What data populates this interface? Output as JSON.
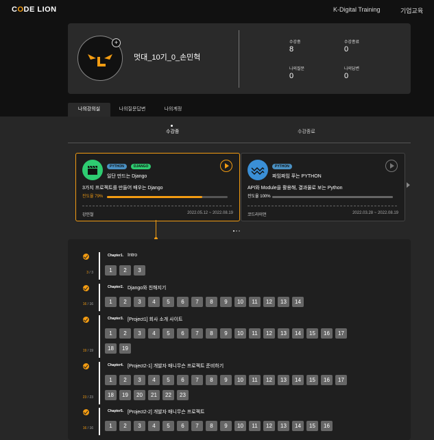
{
  "header": {
    "logo_pre": "C",
    "logo_x": "O",
    "logo_post": "DE LION",
    "nav": [
      "K-Digital Training",
      "기업교육"
    ]
  },
  "profile": {
    "username": "멋대_10기_0_손민혁",
    "stats": [
      {
        "label": "수강중",
        "value": "8"
      },
      {
        "label": "수강종료",
        "value": "0"
      },
      {
        "label": "나의질문",
        "value": "0"
      },
      {
        "label": "나의답변",
        "value": "0"
      }
    ]
  },
  "tabs": [
    "나의강의실",
    "나의질문답변",
    "나의계정"
  ],
  "subtabs": [
    "수강중",
    "수강종료"
  ],
  "colors": {
    "accent": "#f39c12",
    "background": "#181818",
    "card": "#2a2a2a"
  },
  "courses": [
    {
      "icon": "clapperboard-icon",
      "icon_color": "#2ecc71",
      "badges": [
        {
          "text": "PYTHON",
          "bg": "#4a90c2",
          "fg": "#111"
        },
        {
          "text": "DJANGO",
          "bg": "#2ecc71",
          "fg": "#111"
        }
      ],
      "title": "일단 만드는 Django",
      "description": "3가지 프로젝트를 만들어 배우는 Django",
      "progress_label": "진도율 79%",
      "progress": 0.79,
      "instructor": "강민철",
      "period": "2022.05.12 ~ 2022.08.19",
      "active": true
    },
    {
      "icon": "knit-pattern-icon",
      "icon_color": "#3a8fd6",
      "badges": [
        {
          "text": "PYTHON",
          "bg": "#4a90c2",
          "fg": "#111"
        }
      ],
      "title": "짜임짜임 푸는 PYTHON",
      "description": "API와 Module을 활용해, 결과물로 보는 Python",
      "progress_label": "진도율 100%",
      "progress": 1.0,
      "instructor": "코드라이언",
      "period": "2022.03.28 ~ 2022.08.19",
      "active": false
    }
  ],
  "chapters": [
    {
      "label": "Chapter1.",
      "title": "Intro",
      "done": "3",
      "total": "3",
      "lessons": [
        "1",
        "2",
        "3"
      ]
    },
    {
      "label": "Chapter2.",
      "title": "Django와 친해지기",
      "done": "16",
      "total": "16",
      "lessons": [
        "1",
        "2",
        "3",
        "4",
        "5",
        "6",
        "7",
        "8",
        "9",
        "10",
        "11",
        "12",
        "13",
        "14"
      ]
    },
    {
      "label": "Chapter3.",
      "title": "[Project1] 회사 소개 사이트",
      "done": "19",
      "total": "19",
      "lessons": [
        "1",
        "2",
        "3",
        "4",
        "5",
        "6",
        "7",
        "8",
        "9",
        "10",
        "11",
        "12",
        "13",
        "14",
        "15",
        "16",
        "17",
        "18",
        "19"
      ]
    },
    {
      "label": "Chapter4.",
      "title": "[Project2-1] 개발자 매니무슨 프로젝트 준비하기",
      "done": "23",
      "total": "23",
      "lessons": [
        "1",
        "2",
        "3",
        "4",
        "5",
        "6",
        "7",
        "8",
        "9",
        "10",
        "11",
        "12",
        "13",
        "14",
        "15",
        "16",
        "17",
        "18",
        "19",
        "20",
        "21",
        "22",
        "23"
      ]
    },
    {
      "label": "Chapter5.",
      "title": "[Project2-2] 개발자 매니무슨 프로젝트",
      "done": "16",
      "total": "16",
      "lessons": [
        "1",
        "2",
        "3",
        "4",
        "5",
        "6",
        "7",
        "8",
        "9",
        "10",
        "11",
        "12",
        "13",
        "14",
        "15",
        "16"
      ]
    }
  ]
}
